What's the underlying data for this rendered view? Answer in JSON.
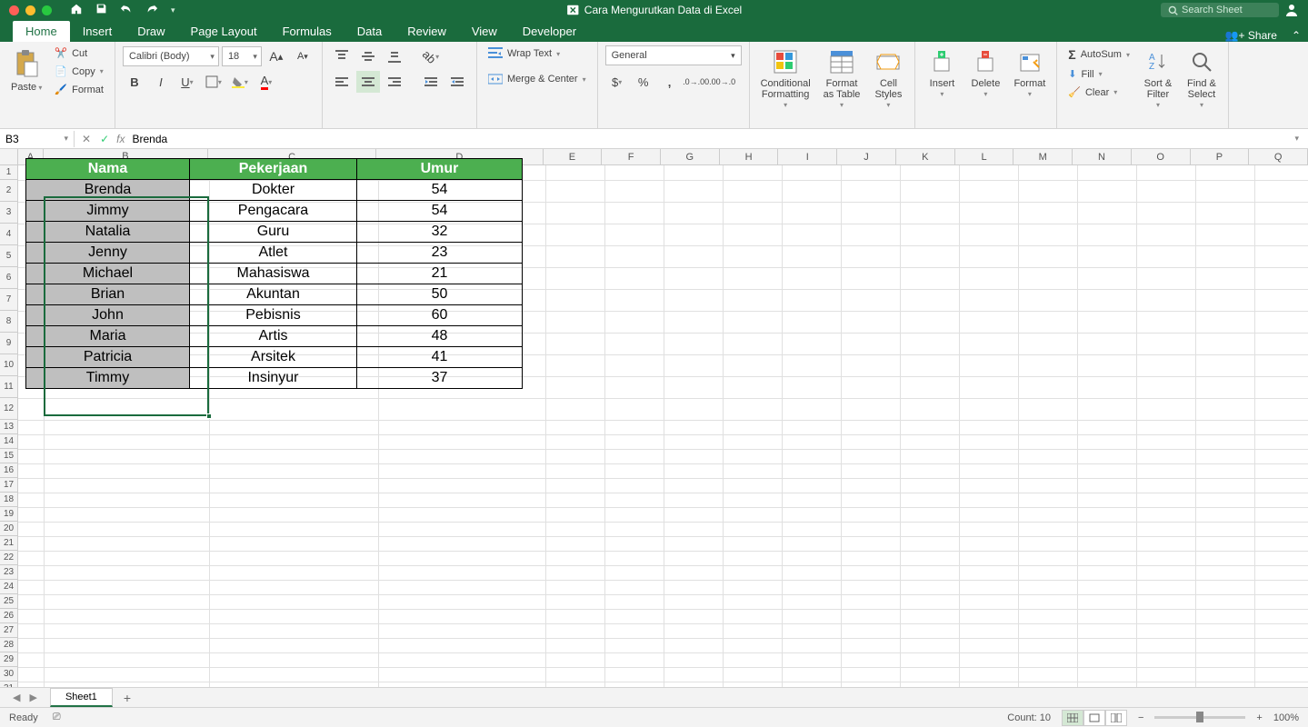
{
  "title": "Cara Mengurutkan Data di Excel",
  "search_placeholder": "Search Sheet",
  "tabs": [
    "Home",
    "Insert",
    "Draw",
    "Page Layout",
    "Formulas",
    "Data",
    "Review",
    "View",
    "Developer"
  ],
  "share": "Share",
  "clipboard": {
    "paste": "Paste",
    "cut": "Cut",
    "copy": "Copy",
    "format": "Format"
  },
  "font": {
    "name": "Calibri (Body)",
    "size": "18"
  },
  "alignment": {
    "wrap": "Wrap Text",
    "merge": "Merge & Center"
  },
  "number": {
    "format": "General"
  },
  "styles": {
    "cond": "Conditional\nFormatting",
    "table": "Format\nas Table",
    "cell": "Cell\nStyles"
  },
  "cells": {
    "insert": "Insert",
    "delete": "Delete",
    "format": "Format"
  },
  "editing": {
    "autosum": "AutoSum",
    "fill": "Fill",
    "clear": "Clear",
    "sort": "Sort &\nFilter",
    "find": "Find &\nSelect"
  },
  "namebox": "B3",
  "formula": "Brenda",
  "columns": [
    "A",
    "B",
    "C",
    "D",
    "E",
    "F",
    "G",
    "H",
    "I",
    "J",
    "K",
    "L",
    "M",
    "N",
    "O",
    "P",
    "Q"
  ],
  "col_widths": {
    "A": 28,
    "B": 182,
    "C": 186,
    "D": 184,
    "other": 65
  },
  "headers": [
    "Nama",
    "Pekerjaan",
    "Umur"
  ],
  "rows": [
    {
      "nama": "Brenda",
      "pekerjaan": "Dokter",
      "umur": "54"
    },
    {
      "nama": "Jimmy",
      "pekerjaan": "Pengacara",
      "umur": "54"
    },
    {
      "nama": "Natalia",
      "pekerjaan": "Guru",
      "umur": "32"
    },
    {
      "nama": "Jenny",
      "pekerjaan": "Atlet",
      "umur": "23"
    },
    {
      "nama": "Michael",
      "pekerjaan": "Mahasiswa",
      "umur": "21"
    },
    {
      "nama": "Brian",
      "pekerjaan": "Akuntan",
      "umur": "50"
    },
    {
      "nama": "John",
      "pekerjaan": "Pebisnis",
      "umur": "60"
    },
    {
      "nama": "Maria",
      "pekerjaan": "Artis",
      "umur": "48"
    },
    {
      "nama": "Patricia",
      "pekerjaan": "Arsitek",
      "umur": "41"
    },
    {
      "nama": "Timmy",
      "pekerjaan": "Insinyur",
      "umur": "37"
    }
  ],
  "sheet": "Sheet1",
  "status": {
    "ready": "Ready",
    "count": "Count: 10",
    "zoom": "100%"
  }
}
